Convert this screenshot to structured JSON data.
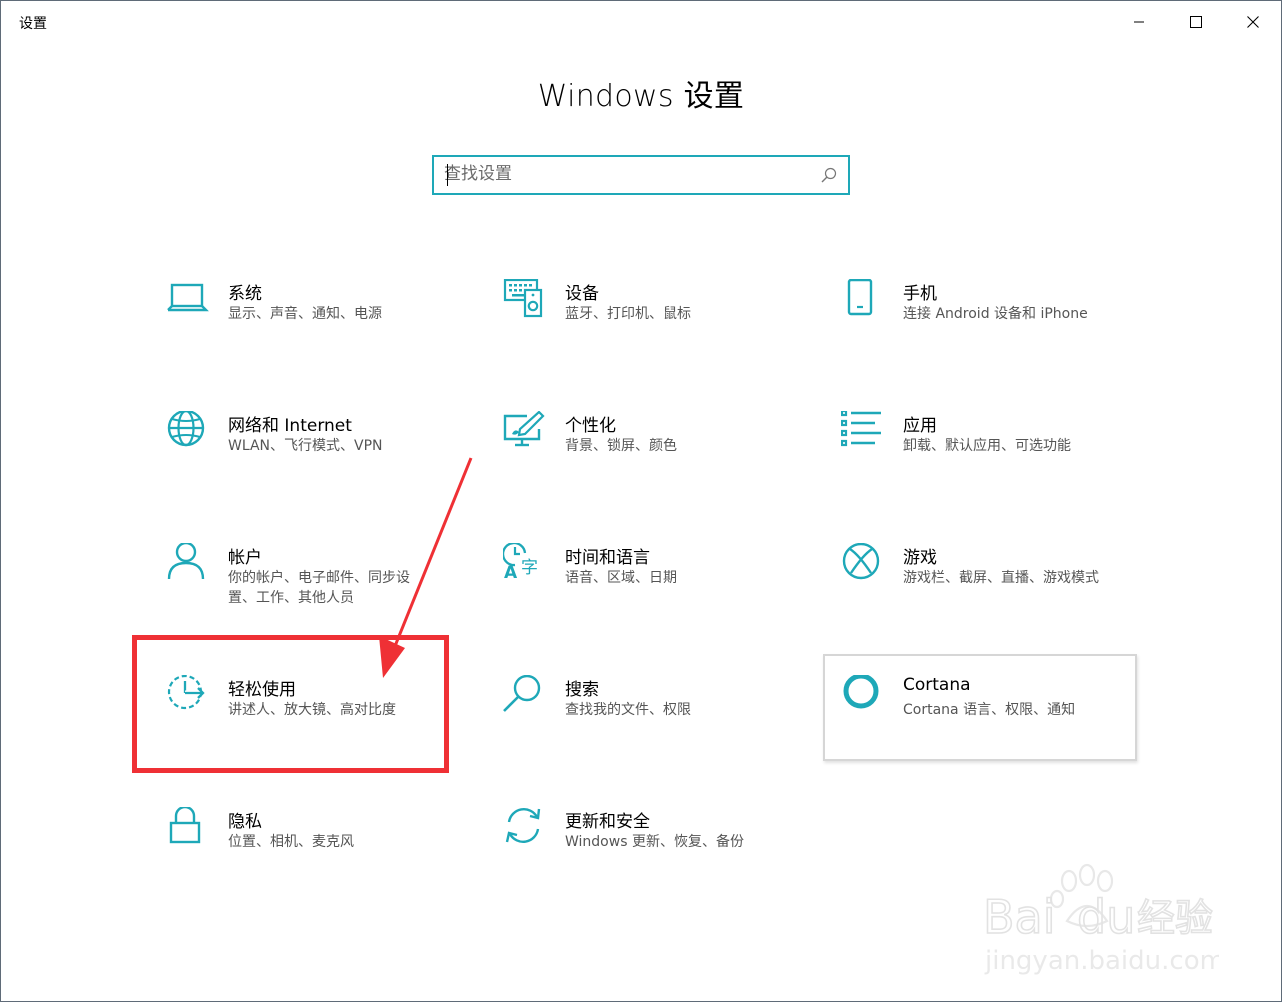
{
  "window": {
    "title": "设置",
    "controls": {
      "minimize": "minimize-icon",
      "maximize": "maximize-icon",
      "close": "close-icon"
    }
  },
  "header": {
    "title": "Windows 设置"
  },
  "search": {
    "placeholder": "查找设置",
    "value": "",
    "icon": "search-icon"
  },
  "categories": [
    {
      "title": "系统",
      "description": "显示、声音、通知、电源",
      "icon": "laptop-icon"
    },
    {
      "title": "设备",
      "description": "蓝牙、打印机、鼠标",
      "icon": "devices-icon"
    },
    {
      "title": "手机",
      "description": "连接 Android 设备和 iPhone",
      "icon": "phone-icon"
    },
    {
      "title": "网络和 Internet",
      "description": "WLAN、飞行模式、VPN",
      "icon": "globe-icon"
    },
    {
      "title": "个性化",
      "description": "背景、锁屏、颜色",
      "icon": "personalization-icon"
    },
    {
      "title": "应用",
      "description": "卸载、默认应用、可选功能",
      "icon": "apps-list-icon"
    },
    {
      "title": "帐户",
      "description": "你的帐户、电子邮件、同步设置、工作、其他人员",
      "icon": "person-icon"
    },
    {
      "title": "时间和语言",
      "description": "语音、区域、日期",
      "icon": "time-language-icon"
    },
    {
      "title": "游戏",
      "description": "游戏栏、截屏、直播、游戏模式",
      "icon": "xbox-icon"
    },
    {
      "title": "轻松使用",
      "description": "讲述人、放大镜、高对比度",
      "icon": "ease-of-access-icon"
    },
    {
      "title": "搜索",
      "description": "查找我的文件、权限",
      "icon": "magnifier-icon"
    },
    {
      "title": "Cortana",
      "description": "Cortana 语言、权限、通知",
      "icon": "cortana-ring-icon"
    },
    {
      "title": "隐私",
      "description": "位置、相机、麦克风",
      "icon": "lock-icon"
    },
    {
      "title": "更新和安全",
      "description": "Windows 更新、恢复、备份",
      "icon": "sync-arrows-icon"
    }
  ],
  "annotation": {
    "highlighted_item": "轻松使用",
    "color": "#ef3035"
  },
  "colors": {
    "accent": "#1ea8b8",
    "annotation": "#ef3035"
  },
  "watermark": {
    "brand": "Bai",
    "brand2": "du",
    "brand_cn": "经验",
    "url": "jingyan.baidu.com"
  }
}
